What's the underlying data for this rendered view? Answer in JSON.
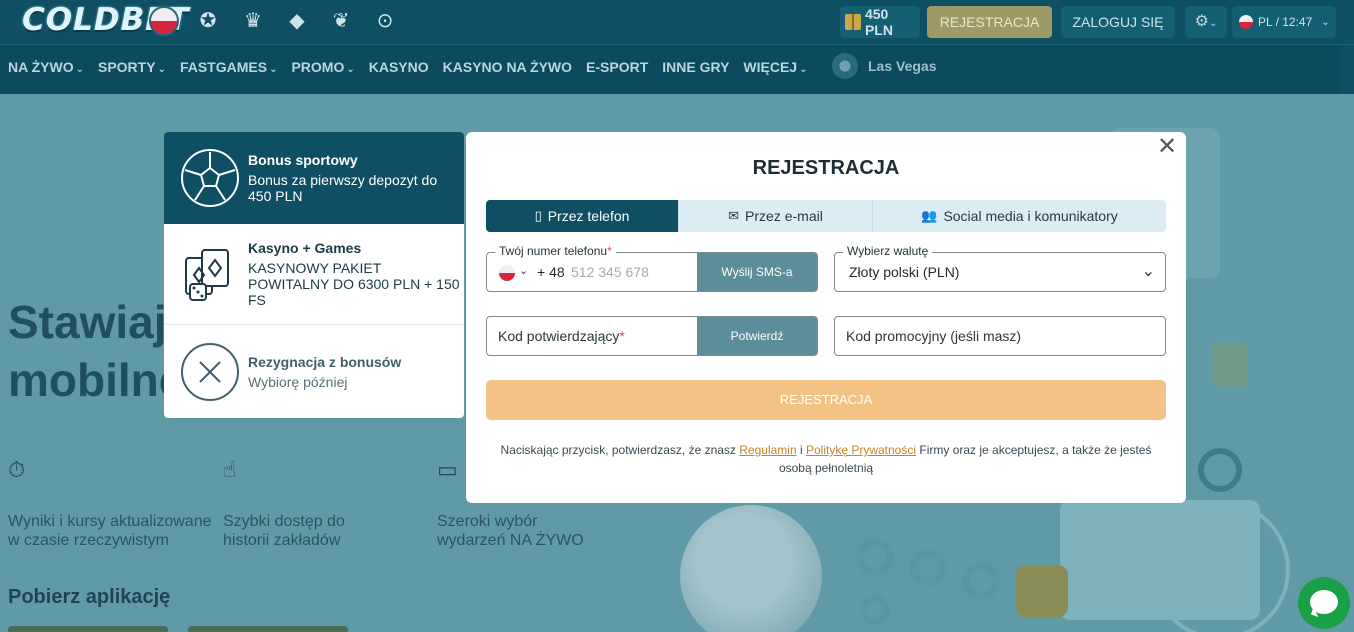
{
  "header": {
    "logo": "COLDBET",
    "league_icons": [
      "poland-flag-icon",
      "champions-league-icon",
      "premier-league-icon",
      "crystal-icon",
      "dragon-icon",
      "play-icon"
    ],
    "balance": "450 PLN",
    "register": "REJESTRACJA",
    "login": "ZALOGUJ SIĘ",
    "lang_time": "PL / 12:47"
  },
  "nav": {
    "items": [
      {
        "label": "NA ŻYWO",
        "dropdown": true
      },
      {
        "label": "SPORTY",
        "dropdown": true
      },
      {
        "label": "FASTGAMES",
        "dropdown": true
      },
      {
        "label": "PROMO",
        "dropdown": true
      },
      {
        "label": "KASYNO",
        "dropdown": false
      },
      {
        "label": "KASYNO NA ŻYWO",
        "dropdown": false
      },
      {
        "label": "E-SPORT",
        "dropdown": false
      },
      {
        "label": "INNE GRY",
        "dropdown": false
      },
      {
        "label": "WIĘCEJ",
        "dropdown": true
      }
    ],
    "vegas": "Las Vegas"
  },
  "background": {
    "headline_1": "Stawiaj",
    "headline_2": "mobilne",
    "features": [
      {
        "line1": "Wyniki i kursy aktualizowane",
        "line2": "w czasie rzeczywistym"
      },
      {
        "line1": "Szybki dostęp do",
        "line2": "historii zakładów"
      },
      {
        "line1": "Szeroki wybór",
        "line2": "wydarzeń NA ŻYWO"
      }
    ],
    "download": "Pobierz aplikację"
  },
  "bonus": {
    "items": [
      {
        "title": "Bonus sportowy",
        "desc": "Bonus za pierwszy depozyt do 450 PLN",
        "icon": "soccer-ball-icon"
      },
      {
        "title": "Kasyno + Games",
        "desc": "KASYNOWY PAKIET POWITALNY DO 6300 PLN + 150 FS",
        "icon": "cards-dice-icon"
      },
      {
        "title": "Rezygnacja z bonusów",
        "desc": "Wybiorę później",
        "icon": "cancel-circle-icon"
      }
    ]
  },
  "modal": {
    "title": "REJESTRACJA",
    "tabs": [
      {
        "label": "Przez telefon",
        "icon": "phone-icon",
        "active": true
      },
      {
        "label": "Przez e-mail",
        "icon": "envelope-icon",
        "active": false
      },
      {
        "label": "Social media i komunikatory",
        "icon": "users-icon",
        "active": false
      }
    ],
    "phone_label": "Twój numer telefonu",
    "phone_prefix": "+ 48",
    "phone_placeholder": "512 345 678",
    "sms_button": "Wyślij SMS-a",
    "currency_label": "Wybierz walutę",
    "currency_value": "Złoty polski (PLN)",
    "code_placeholder": "Kod potwierdzający",
    "confirm_button": "Potwierdź",
    "promo_placeholder": "Kod promocyjny (jeśli masz)",
    "register_button": "REJESTRACJA",
    "terms_1": "Naciskając przycisk, potwierdzasz, że znasz ",
    "terms_link_1": "Regulamin",
    "terms_2": " i ",
    "terms_link_2": "Politykę Prywatności",
    "terms_3": " Firmy oraz je akceptujesz, a także że jesteś osobą pełnoletnią"
  },
  "colors": {
    "header_bg": "#0e4f63",
    "accent_orange": "#f2c384",
    "button_teal": "#5c8e99",
    "overlay_bg": "#5f9aa6",
    "chat_green": "#1aa148"
  }
}
